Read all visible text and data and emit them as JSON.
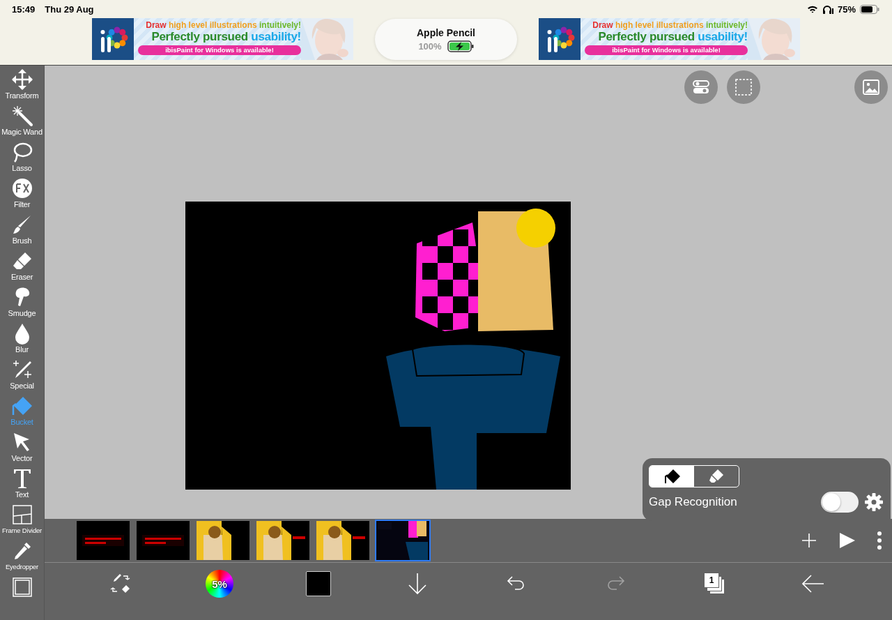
{
  "status_bar": {
    "time": "15:49",
    "date": "Thu 29 Aug",
    "battery": "75%"
  },
  "ads": [
    {
      "headline": [
        "Draw",
        "high level illustrations",
        "intuitively!"
      ],
      "tagline": [
        "Perfectly pursued",
        "usability!"
      ],
      "banner": "ibisPaint for Windows is available!"
    },
    {
      "headline": [
        "Draw",
        "high level illustrations",
        "intuitively!"
      ],
      "tagline": [
        "Perfectly pursued",
        "usability!"
      ],
      "banner": "ibisPaint for Windows is available!"
    }
  ],
  "pencil": {
    "name": "Apple Pencil",
    "battery": "100%",
    "charging": true
  },
  "tools": [
    {
      "kind": "transform",
      "label": "Transform",
      "selected": false
    },
    {
      "kind": "wand",
      "label": "Magic Wand",
      "selected": false
    },
    {
      "kind": "lasso",
      "label": "Lasso",
      "selected": false
    },
    {
      "kind": "filter",
      "label": "Filter",
      "selected": false
    },
    {
      "kind": "brush",
      "label": "Brush",
      "selected": false
    },
    {
      "kind": "eraser",
      "label": "Eraser",
      "selected": false
    },
    {
      "kind": "smudge",
      "label": "Smudge",
      "selected": false
    },
    {
      "kind": "blur",
      "label": "Blur",
      "selected": false
    },
    {
      "kind": "special",
      "label": "Special",
      "selected": false
    },
    {
      "kind": "bucket",
      "label": "Bucket",
      "selected": true
    },
    {
      "kind": "vector",
      "label": "Vector",
      "selected": false
    },
    {
      "kind": "text",
      "label": "Text",
      "selected": false
    },
    {
      "kind": "divider",
      "label": "Frame Divider",
      "selected": false
    },
    {
      "kind": "eyedropper",
      "label": "Eyedropper",
      "selected": false
    },
    {
      "kind": "canvas",
      "selected": false
    }
  ],
  "bucket_panel": {
    "modes": [
      {
        "kind": "fill",
        "selected": true
      },
      {
        "kind": "erase",
        "selected": false
      }
    ],
    "gap_recognition": {
      "label": "Gap Recognition",
      "on": false
    }
  },
  "frames": [
    {
      "selected": false
    },
    {
      "selected": false
    },
    {
      "selected": false
    },
    {
      "selected": false
    },
    {
      "selected": false
    },
    {
      "selected": true
    }
  ],
  "bottom_bar": {
    "brush_size": "5%",
    "layers": "1",
    "undo_disabled": false,
    "redo_disabled": true
  }
}
